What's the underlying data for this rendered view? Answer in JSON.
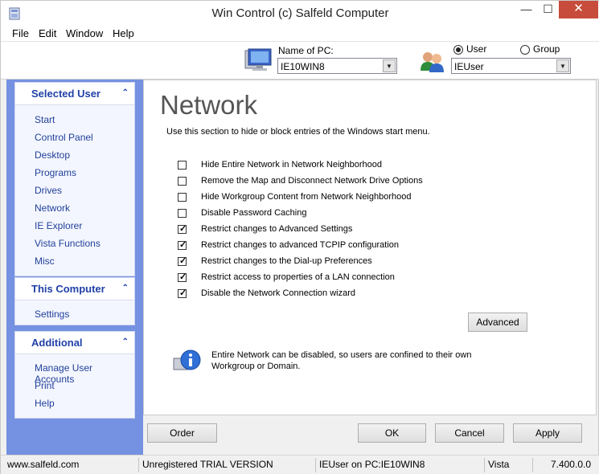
{
  "window": {
    "title": "Win Control (c) Salfeld Computer",
    "min": "—",
    "max": "☐",
    "close": "✕"
  },
  "menu": [
    "File",
    "Edit",
    "Window",
    "Help"
  ],
  "toolbar": {
    "pc_label": "Name of PC:",
    "pc_value": "IE10WIN8",
    "user_radio": "User",
    "group_radio": "Group",
    "selected_radio": "User",
    "user_value": "IEUser"
  },
  "sidebar": {
    "selected_user": {
      "title": "Selected User",
      "items": [
        "Start",
        "Control Panel",
        "Desktop",
        "Programs",
        "Drives",
        "Network",
        "IE Explorer",
        "Vista Functions",
        "Misc"
      ]
    },
    "this_computer": {
      "title": "This Computer",
      "items": [
        "Settings"
      ]
    },
    "additional": {
      "title": "Additional",
      "items": [
        "Manage User Accounts",
        "Print",
        "Help"
      ]
    }
  },
  "content": {
    "title": "Network",
    "intro": "Use this section to hide or block entries of the Windows start menu.",
    "options": [
      {
        "label": "Hide Entire Network in Network Neighborhood",
        "checked": false
      },
      {
        "label": "Remove the Map and Disconnect Network Drive Options",
        "checked": false
      },
      {
        "label": "Hide Workgroup Content from Network Neighborhood",
        "checked": false
      },
      {
        "label": "Disable Password Caching",
        "checked": false
      },
      {
        "label": "Restrict changes to Advanced Settings",
        "checked": true
      },
      {
        "label": "Restrict changes to advanced TCPIP configuration",
        "checked": true
      },
      {
        "label": "Restrict changes to the Dial-up Preferences",
        "checked": true
      },
      {
        "label": "Restrict access to properties of a LAN connection",
        "checked": true
      },
      {
        "label": "Disable the Network Connection wizard",
        "checked": true
      }
    ],
    "advanced_button": "Advanced",
    "info": [
      "Entire Network can be disabled, so users are confined to their own",
      "Workgroup or Domain."
    ]
  },
  "buttons": {
    "order": "Order",
    "ok": "OK",
    "cancel": "Cancel",
    "apply": "Apply"
  },
  "status": {
    "site": "www.salfeld.com",
    "license": "Unregistered TRIAL VERSION",
    "session": "IEUser on PC:IE10WIN8",
    "os": "Vista",
    "version": "7.400.0.0"
  },
  "colors": {
    "sidebar_bg": "#7591e1",
    "link": "#214199",
    "panel_title": "#2141a8",
    "close_btn": "#c74c3b"
  }
}
